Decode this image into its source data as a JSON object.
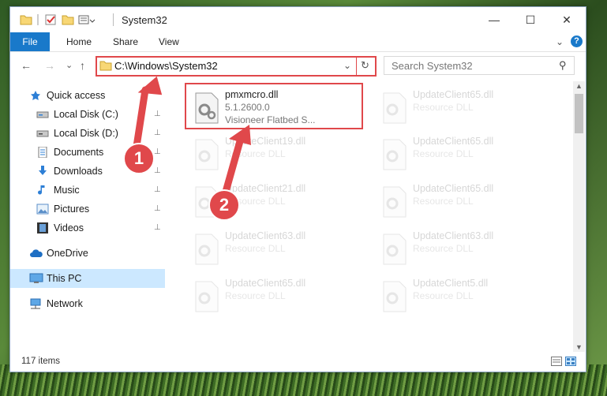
{
  "window": {
    "title": "System32",
    "minimize_glyph": "—",
    "maximize_glyph": "☐",
    "close_glyph": "✕"
  },
  "ribbon": {
    "tabs": [
      "File",
      "Home",
      "Share",
      "View"
    ],
    "expand_glyph": "⌄",
    "help_glyph": "?"
  },
  "address": {
    "path": "C:\\Windows\\System32",
    "search_placeholder": "Search System32",
    "back_glyph": "←",
    "forward_glyph": "→",
    "recent_glyph": "⌄",
    "up_glyph": "↑",
    "dropdown_glyph": "⌄",
    "refresh_glyph": "↻",
    "search_glyph": "⚲"
  },
  "nav": {
    "items": [
      {
        "label": "Quick access",
        "icon": "star-icon",
        "pinned": false
      },
      {
        "label": "Local Disk (C:)",
        "icon": "drive-icon",
        "pinned": true
      },
      {
        "label": "Local Disk (D:)",
        "icon": "drive-icon",
        "pinned": true
      },
      {
        "label": "Documents",
        "icon": "document-icon",
        "pinned": true
      },
      {
        "label": "Downloads",
        "icon": "download-icon",
        "pinned": true
      },
      {
        "label": "Music",
        "icon": "music-icon",
        "pinned": true
      },
      {
        "label": "Pictures",
        "icon": "pictures-icon",
        "pinned": true
      },
      {
        "label": "Videos",
        "icon": "videos-icon",
        "pinned": true
      },
      {
        "label": "OneDrive",
        "icon": "cloud-icon",
        "pinned": false
      },
      {
        "label": "This PC",
        "icon": "computer-icon",
        "pinned": false,
        "selected": true
      },
      {
        "label": "Network",
        "icon": "network-icon",
        "pinned": false
      }
    ],
    "pin_glyph": "📌"
  },
  "files": [
    {
      "name": "pmxmcro.dll",
      "line2": "5.1.2600.0",
      "line3": "Visioneer Flatbed S...",
      "highlight": true
    },
    {
      "name": "UpdateClient65.dll",
      "line2": "Resource DLL"
    },
    {
      "name": "UpdateClient19.dll",
      "line2": "Resource DLL"
    },
    {
      "name": "UpdateClient65.dll",
      "line2": "Resource DLL"
    },
    {
      "name": "UpdateClient21.dll",
      "line2": "Resource DLL"
    },
    {
      "name": "UpdateClient65.dll",
      "line2": "Resource DLL"
    },
    {
      "name": "UpdateClient63.dll",
      "line2": "Resource DLL"
    },
    {
      "name": "UpdateClient63.dll",
      "line2": "Resource DLL"
    },
    {
      "name": "UpdateClient65.dll",
      "line2": "Resource DLL"
    },
    {
      "name": "UpdateClient5.dll",
      "line2": "Resource DLL"
    }
  ],
  "status": {
    "count": "117 items"
  },
  "annotations": {
    "step1": "1",
    "step2": "2"
  },
  "colors": {
    "accent": "#1979ca",
    "highlight": "#e0484b",
    "selection": "#cce8ff"
  }
}
